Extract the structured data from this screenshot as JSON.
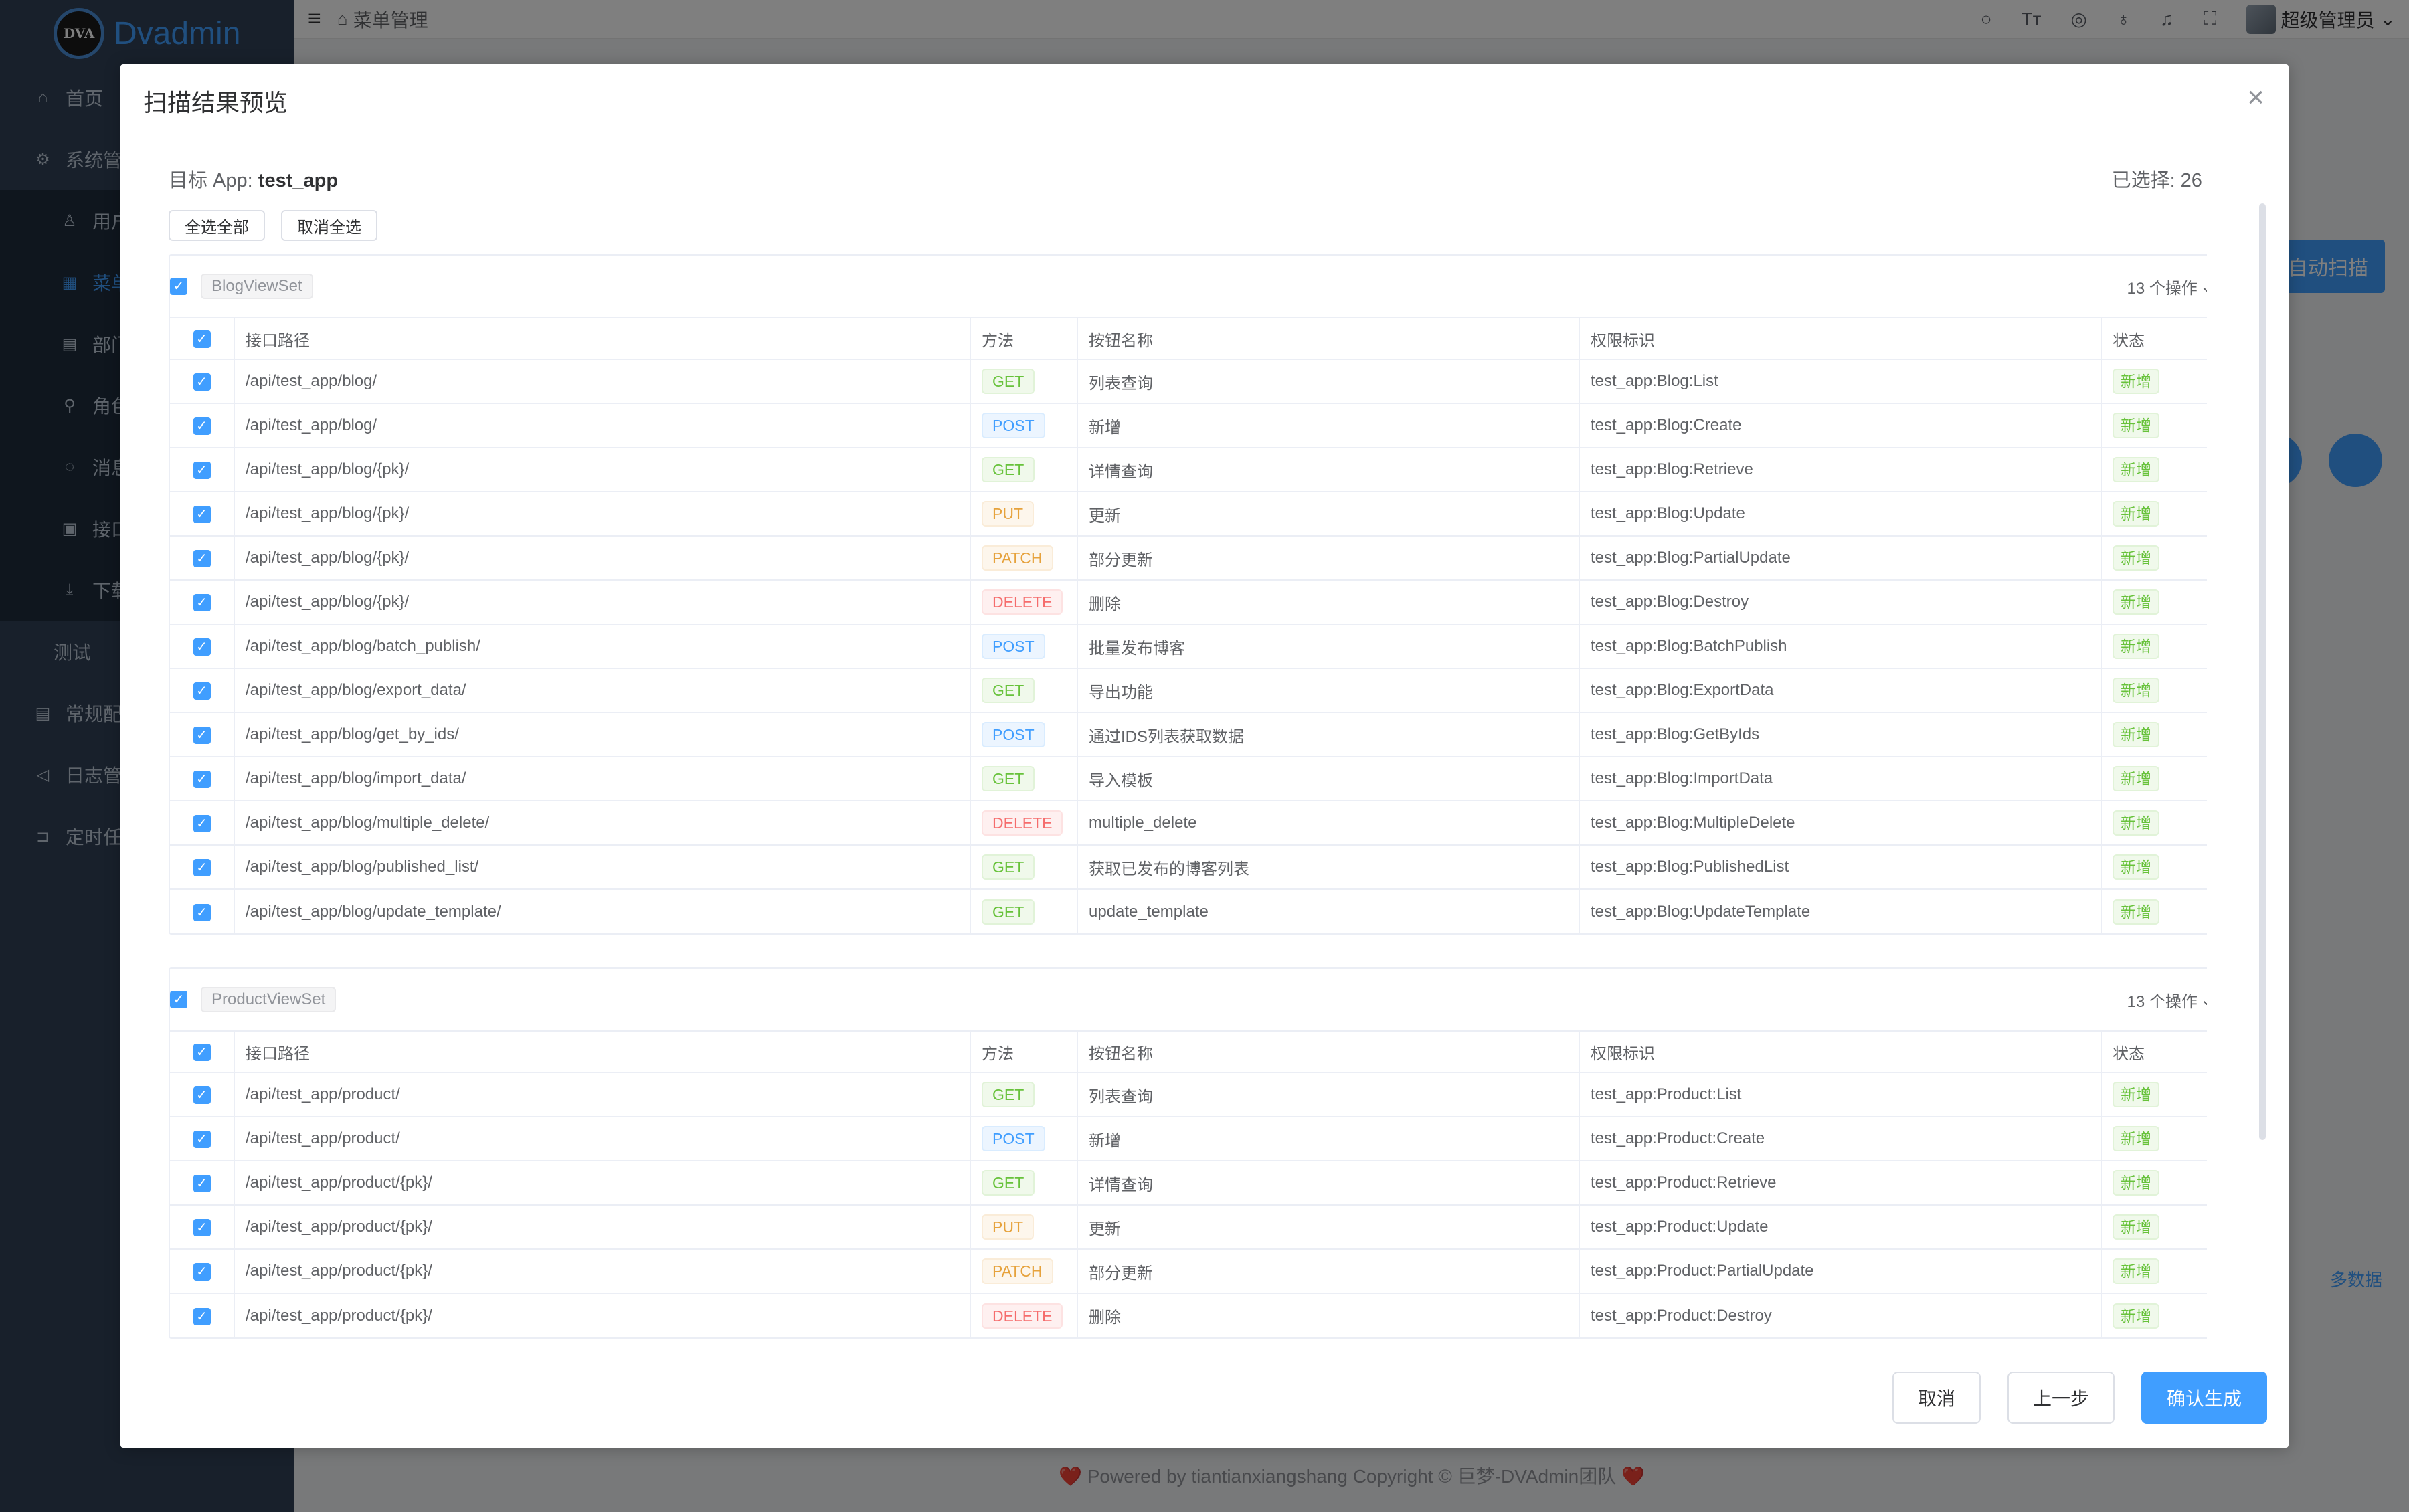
{
  "app": {
    "logo_badge": "DVA",
    "logo_text": "Dvadmin"
  },
  "sidebar": {
    "items": [
      {
        "label": "首页",
        "icon": "home-icon",
        "glyph": "⌂"
      },
      {
        "label": "系统管",
        "icon": "gear-icon",
        "glyph": "⚙"
      },
      {
        "label": "用户",
        "icon": "user-icon",
        "glyph": "♙"
      },
      {
        "label": "菜单",
        "icon": "grid-icon",
        "glyph": "▦"
      },
      {
        "label": "部门",
        "icon": "org-icon",
        "glyph": "▤"
      },
      {
        "label": "角色",
        "icon": "role-icon",
        "glyph": "⚲"
      },
      {
        "label": "消息",
        "icon": "message-icon",
        "glyph": "◌"
      },
      {
        "label": "接口",
        "icon": "api-icon",
        "glyph": "▣"
      },
      {
        "label": "下载",
        "icon": "download-icon",
        "glyph": "⤓"
      },
      {
        "label": "测试",
        "icon": "",
        "glyph": ""
      },
      {
        "label": "常规配",
        "icon": "config-icon",
        "glyph": "▤"
      },
      {
        "label": "日志管",
        "icon": "log-icon",
        "glyph": "◁"
      },
      {
        "label": "定时任",
        "icon": "timer-icon",
        "glyph": "⊐"
      }
    ]
  },
  "topbar": {
    "breadcrumb": "菜单管理",
    "user": "超级管理员",
    "text_size_icon": "Tт"
  },
  "background": {
    "auto_scan": "自动扫描",
    "hint": "多数据"
  },
  "footer": {
    "text": "❤️ Powered by tiantianxiangshang Copyright © 巨梦-DVAdmin团队 ❤️"
  },
  "dialog": {
    "title": "扫描结果预览",
    "target_label": "目标 App:",
    "target_app": "test_app",
    "selected_text": "已选择: 26 项",
    "select_all": "全选全部",
    "deselect_all": "取消全选",
    "columns": [
      "接口路径",
      "方法",
      "按钮名称",
      "权限标识",
      "状态"
    ],
    "groups": [
      {
        "name": "BlogViewSet",
        "count": "13 个操作",
        "rows": [
          {
            "path": "/api/test_app/blog/",
            "method": "GET",
            "name": "列表查询",
            "perm": "test_app:Blog:List",
            "status": "新增"
          },
          {
            "path": "/api/test_app/blog/",
            "method": "POST",
            "name": "新增",
            "perm": "test_app:Blog:Create",
            "status": "新增"
          },
          {
            "path": "/api/test_app/blog/{pk}/",
            "method": "GET",
            "name": "详情查询",
            "perm": "test_app:Blog:Retrieve",
            "status": "新增"
          },
          {
            "path": "/api/test_app/blog/{pk}/",
            "method": "PUT",
            "name": "更新",
            "perm": "test_app:Blog:Update",
            "status": "新增"
          },
          {
            "path": "/api/test_app/blog/{pk}/",
            "method": "PATCH",
            "name": "部分更新",
            "perm": "test_app:Blog:PartialUpdate",
            "status": "新增"
          },
          {
            "path": "/api/test_app/blog/{pk}/",
            "method": "DELETE",
            "name": "删除",
            "perm": "test_app:Blog:Destroy",
            "status": "新增"
          },
          {
            "path": "/api/test_app/blog/batch_publish/",
            "method": "POST",
            "name": "批量发布博客",
            "perm": "test_app:Blog:BatchPublish",
            "status": "新增"
          },
          {
            "path": "/api/test_app/blog/export_data/",
            "method": "GET",
            "name": "导出功能",
            "perm": "test_app:Blog:ExportData",
            "status": "新增"
          },
          {
            "path": "/api/test_app/blog/get_by_ids/",
            "method": "POST",
            "name": "通过IDS列表获取数据",
            "perm": "test_app:Blog:GetByIds",
            "status": "新增"
          },
          {
            "path": "/api/test_app/blog/import_data/",
            "method": "GET",
            "name": "导入模板",
            "perm": "test_app:Blog:ImportData",
            "status": "新增"
          },
          {
            "path": "/api/test_app/blog/multiple_delete/",
            "method": "DELETE",
            "name": "multiple_delete",
            "perm": "test_app:Blog:MultipleDelete",
            "status": "新增"
          },
          {
            "path": "/api/test_app/blog/published_list/",
            "method": "GET",
            "name": "获取已发布的博客列表",
            "perm": "test_app:Blog:PublishedList",
            "status": "新增"
          },
          {
            "path": "/api/test_app/blog/update_template/",
            "method": "GET",
            "name": "update_template",
            "perm": "test_app:Blog:UpdateTemplate",
            "status": "新增"
          }
        ]
      },
      {
        "name": "ProductViewSet",
        "count": "13 个操作",
        "rows": [
          {
            "path": "/api/test_app/product/",
            "method": "GET",
            "name": "列表查询",
            "perm": "test_app:Product:List",
            "status": "新增"
          },
          {
            "path": "/api/test_app/product/",
            "method": "POST",
            "name": "新增",
            "perm": "test_app:Product:Create",
            "status": "新增"
          },
          {
            "path": "/api/test_app/product/{pk}/",
            "method": "GET",
            "name": "详情查询",
            "perm": "test_app:Product:Retrieve",
            "status": "新增"
          },
          {
            "path": "/api/test_app/product/{pk}/",
            "method": "PUT",
            "name": "更新",
            "perm": "test_app:Product:Update",
            "status": "新增"
          },
          {
            "path": "/api/test_app/product/{pk}/",
            "method": "PATCH",
            "name": "部分更新",
            "perm": "test_app:Product:PartialUpdate",
            "status": "新增"
          },
          {
            "path": "/api/test_app/product/{pk}/",
            "method": "DELETE",
            "name": "删除",
            "perm": "test_app:Product:Destroy",
            "status": "新增"
          }
        ]
      }
    ],
    "footer": {
      "cancel": "取消",
      "prev": "上一步",
      "confirm": "确认生成"
    }
  },
  "colors": {
    "primary": "#409eff",
    "sidebar_bg": "#304156",
    "success": "#67c23a",
    "warning": "#e6a23c",
    "danger": "#f56c6c"
  }
}
